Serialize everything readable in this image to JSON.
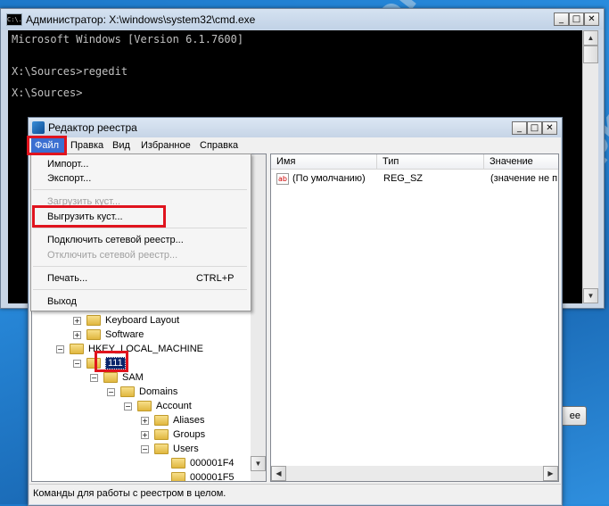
{
  "cmd": {
    "title": "Администратор: X:\\windows\\system32\\cmd.exe",
    "icon_label": "C:\\.",
    "lines": [
      "Microsoft Windows [Version 6.1.7600]",
      "",
      "X:\\Sources>regedit",
      "",
      "X:\\Sources>"
    ]
  },
  "regedit": {
    "title": "Редактор реестра",
    "menu": [
      "Файл",
      "Правка",
      "Вид",
      "Избранное",
      "Справка"
    ],
    "columns": [
      "Имя",
      "Тип",
      "Значение"
    ],
    "values": [
      {
        "name": "(По умолчанию)",
        "type": "REG_SZ",
        "data": "(значение не п"
      }
    ],
    "status": "Команды для работы с реестром в целом.",
    "tree": [
      {
        "label": "Keyboard Layout",
        "exp": "+"
      },
      {
        "label": "Software",
        "exp": "+"
      },
      {
        "label": "HKEY_LOCAL_MACHINE",
        "exp": "−"
      },
      {
        "label": "111",
        "exp": "−"
      },
      {
        "label": "SAM",
        "exp": "−"
      },
      {
        "label": "Domains",
        "exp": "−"
      },
      {
        "label": "Account",
        "exp": "−"
      },
      {
        "label": "Aliases",
        "exp": "+"
      },
      {
        "label": "Groups",
        "exp": "+"
      },
      {
        "label": "Users",
        "exp": "−"
      },
      {
        "label": "000001F4",
        "exp": ""
      },
      {
        "label": "000001F5",
        "exp": ""
      }
    ]
  },
  "file_menu": {
    "items": [
      {
        "label": "Импорт...",
        "enabled": true
      },
      {
        "label": "Экспорт...",
        "enabled": true
      },
      {
        "label": "Загрузить куст...",
        "enabled": false
      },
      {
        "label": "Выгрузить куст...",
        "enabled": true
      },
      {
        "label": "Подключить сетевой реестр...",
        "enabled": true
      },
      {
        "label": "Отключить сетевой реестр...",
        "enabled": false
      },
      {
        "label": "Печать...",
        "enabled": true,
        "shortcut": "CTRL+P"
      },
      {
        "label": "Выход",
        "enabled": true
      }
    ]
  },
  "background_button_label": "ее",
  "watermark": "pk-help.com",
  "colors": {
    "highlight": "#e0141e",
    "console_bg": "#000000",
    "console_fg": "#c0c0c0",
    "selected": "#0a246a"
  }
}
